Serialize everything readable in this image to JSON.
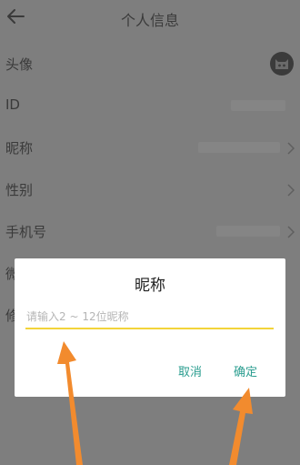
{
  "header": {
    "title": "个人信息"
  },
  "rows": [
    {
      "label": "头像"
    },
    {
      "label": "ID"
    },
    {
      "label": "昵称"
    },
    {
      "label": "性别"
    },
    {
      "label": "手机号"
    },
    {
      "label": "微"
    },
    {
      "label": "修"
    }
  ],
  "dialog": {
    "title": "昵称",
    "input_placeholder": "请输入2 ~ 12位昵称",
    "input_value": "",
    "cancel_label": "取消",
    "ok_label": "确定"
  },
  "colors": {
    "accent": "#2a9d8f",
    "input_underline": "#f3d43a",
    "arrow": "#f28b2e",
    "overlay_bg": "#7e7e7e"
  },
  "icons": {
    "back": "arrow-left-icon",
    "chevron": "chevron-right-icon",
    "avatar": "cat-avatar-icon"
  }
}
